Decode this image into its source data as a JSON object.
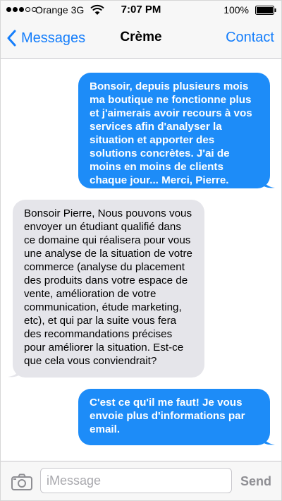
{
  "status_bar": {
    "carrier": "Orange 3G",
    "time": "7:07 PM",
    "battery": "100%",
    "signal_filled": 3,
    "signal_total": 5
  },
  "nav": {
    "back_label": "Messages",
    "title": "Crème",
    "contact_label": "Contact"
  },
  "messages": [
    {
      "direction": "outgoing",
      "text": "Bonsoir, depuis plusieurs mois ma boutique ne fonctionne plus et j'aimerais avoir recours à vos services afin d'analyser la situation et apporter des solutions concrètes. J'ai de moins en moins de clients chaque jour... Merci, Pierre."
    },
    {
      "direction": "incoming",
      "text": "Bonsoir Pierre, Nous pouvons vous envoyer un étudiant qualifié dans ce domaine qui réalisera pour vous une analyse de la situation de votre commerce (analyse du placement des produits dans votre espace de vente, amélioration de votre communication, étude marketing, etc), et qui par la suite vous fera des recommandations précises pour améliorer la situation. Est-ce que cela vous conviendrait?"
    },
    {
      "direction": "outgoing",
      "text": "C'est ce qu'il me faut! Je vous envoie plus d'informations par email."
    }
  ],
  "input": {
    "placeholder": "iMessage",
    "value": "",
    "send_label": "Send"
  },
  "icons": {
    "back": "chevron-left-icon",
    "camera": "camera-icon",
    "wifi": "wifi-icon",
    "battery": "battery-icon"
  },
  "colors": {
    "accent": "#157efb",
    "outgoing_bubble": "#1d8cf8",
    "incoming_bubble": "#e5e5ea",
    "bar_background": "#f7f7f7",
    "send_disabled": "#8e8e93"
  }
}
